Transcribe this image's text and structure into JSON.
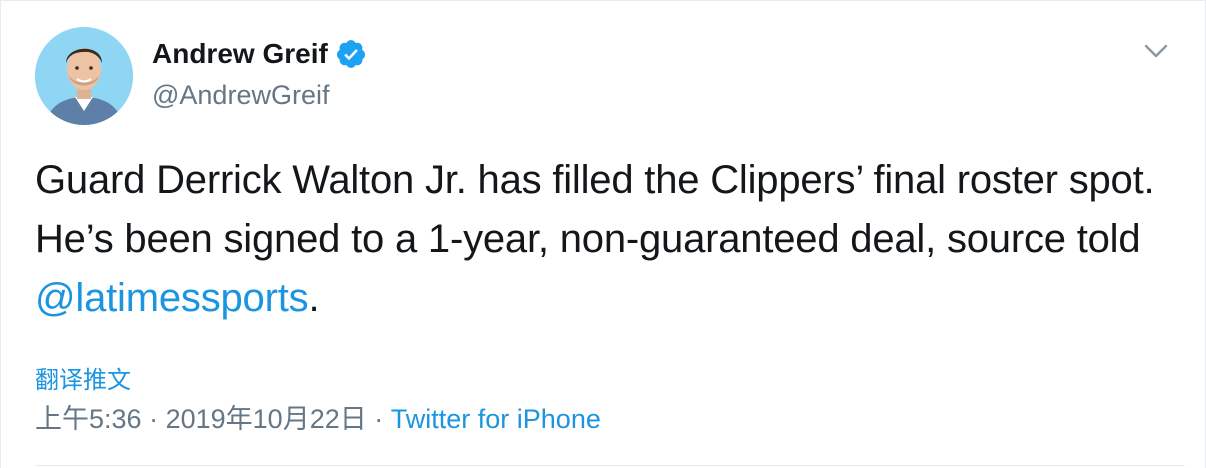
{
  "tweet": {
    "author": {
      "name": "Andrew Greif",
      "handle": "@AndrewGreif",
      "verified": true,
      "avatar_icon": "person-avatar-icon"
    },
    "text_before_mention": "Guard Derrick Walton Jr. has filled the Clippers’ final roster spot. He’s been signed to a 1-year, non-guaranteed deal, source told ",
    "mention": "@latimessports",
    "text_after_mention": ".",
    "translate_label": "翻译推文",
    "time": "上午5:36",
    "separator": "·",
    "date": "2019年10月22日",
    "source": "Twitter for iPhone"
  },
  "icons": {
    "verified": "verified-badge-icon",
    "caret": "chevron-down-icon"
  },
  "colors": {
    "link_blue": "#1b95e0",
    "verified_blue": "#1da1f2",
    "text_dark": "#14171a",
    "text_muted": "#657786",
    "divider": "#e6ecf0"
  }
}
